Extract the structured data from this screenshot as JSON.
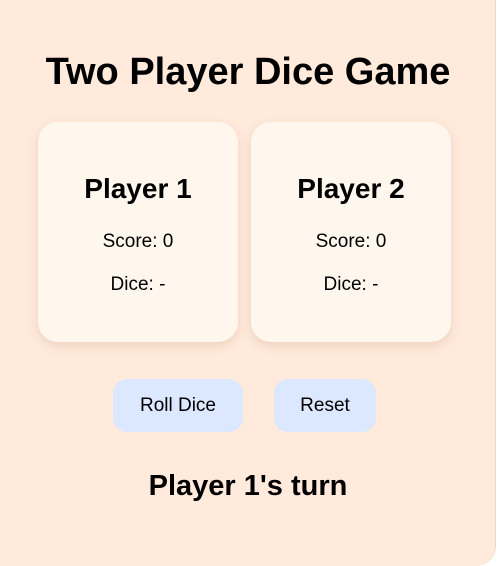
{
  "app": {
    "title": "Two Player Dice Game"
  },
  "players": [
    {
      "name": "Player 1",
      "score_text": "Score: 0",
      "dice_text": "Dice: -"
    },
    {
      "name": "Player 2",
      "score_text": "Score: 0",
      "dice_text": "Dice: -"
    }
  ],
  "controls": {
    "roll_label": "Roll Dice",
    "reset_label": "Reset"
  },
  "status": {
    "turn_text": "Player 1's turn"
  },
  "colors": {
    "background": "#ffeadb",
    "card": "#fff7ed",
    "button": "#dbe8ff",
    "text": "#000000"
  }
}
